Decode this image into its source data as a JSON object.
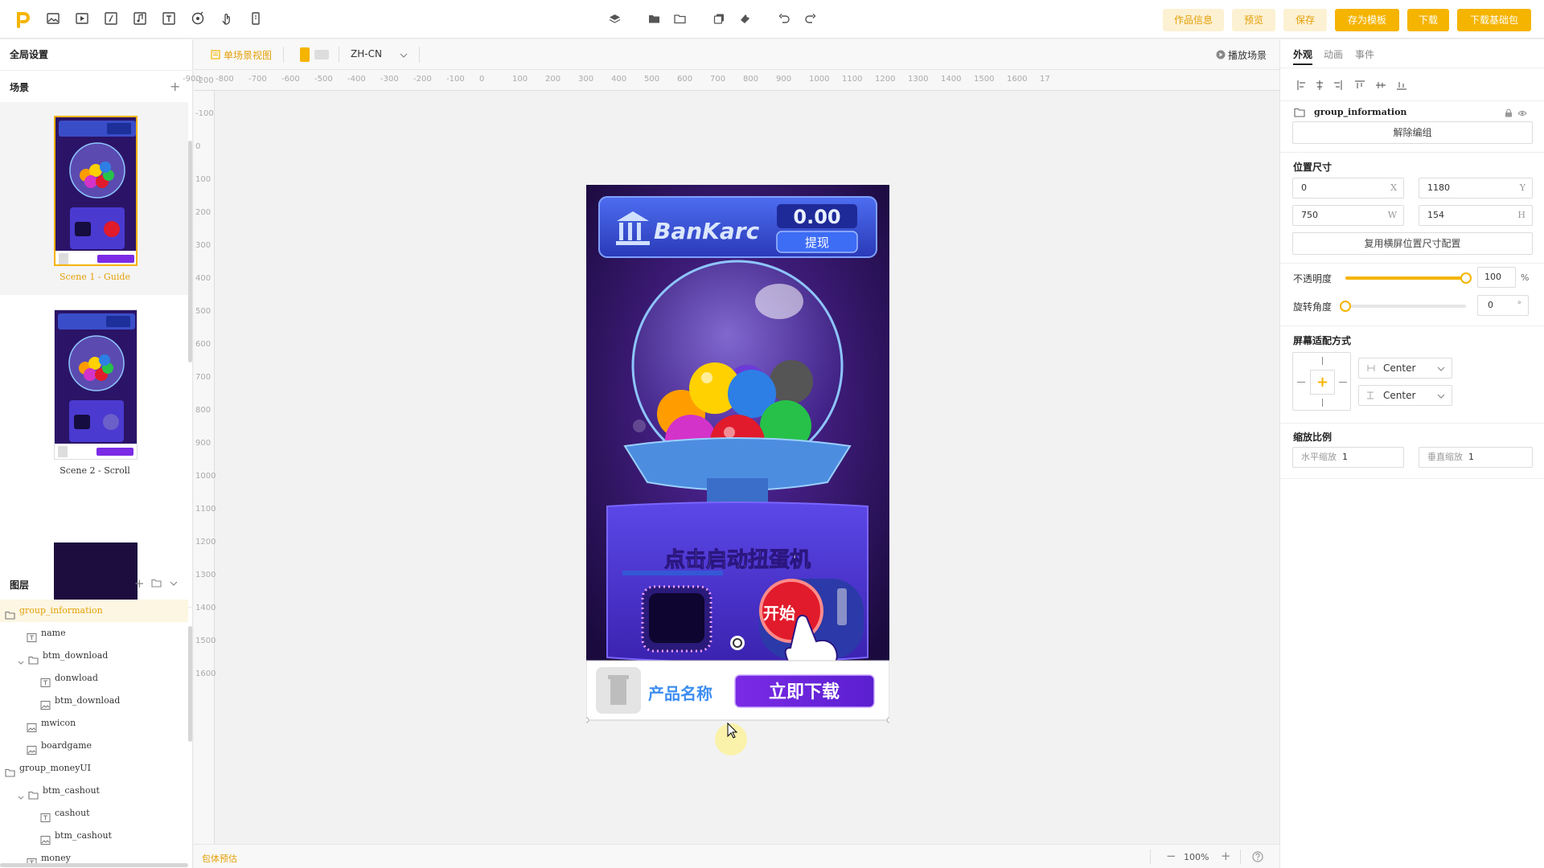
{
  "toolbar": {
    "buttons": {
      "work_info": "作品信息",
      "preview": "预览",
      "save": "保存",
      "save_template": "存为模板",
      "download": "下载",
      "download_base": "下载基础包"
    }
  },
  "left": {
    "global_settings": "全局设置",
    "scenes_title": "场景",
    "scenes": [
      {
        "label": "Scene 1 - Guide"
      },
      {
        "label": "Scene 2 - Scroll"
      }
    ],
    "layers_title": "图层",
    "layers": [
      {
        "name": "group_information",
        "type": "folder",
        "indent": 0,
        "selected": true
      },
      {
        "name": "name",
        "type": "text",
        "indent": 1
      },
      {
        "name": "btm_download",
        "type": "folder",
        "indent": 1,
        "expanded": true
      },
      {
        "name": "donwload",
        "type": "text",
        "indent": 2
      },
      {
        "name": "btm_download",
        "type": "image",
        "indent": 2
      },
      {
        "name": "mwicon",
        "type": "image",
        "indent": 1
      },
      {
        "name": "boardgame",
        "type": "image",
        "indent": 1
      },
      {
        "name": "group_moneyUI",
        "type": "folder",
        "indent": 0
      },
      {
        "name": "btm_cashout",
        "type": "folder",
        "indent": 1,
        "expanded": true
      },
      {
        "name": "cashout",
        "type": "text",
        "indent": 2
      },
      {
        "name": "btm_cashout",
        "type": "image",
        "indent": 2
      },
      {
        "name": "money",
        "type": "text",
        "indent": 1
      }
    ]
  },
  "subtoolbar": {
    "single_view": "单场景视图",
    "language": "ZH-CN",
    "play_scene": "播放场景"
  },
  "ruler": {
    "h": [
      "-900",
      "-800",
      "-700",
      "-600",
      "-500",
      "-400",
      "-300",
      "-200",
      "-100",
      "0",
      "100",
      "200",
      "300",
      "400",
      "500",
      "600",
      "700",
      "800",
      "900",
      "1000",
      "1100",
      "1200",
      "1300",
      "1400",
      "1500",
      "1600",
      "17"
    ],
    "v": [
      "-200",
      "-100",
      "0",
      "100",
      "200",
      "300",
      "400",
      "500",
      "600",
      "700",
      "800",
      "900",
      "1000",
      "1100",
      "1200",
      "1300",
      "1400",
      "1500",
      "1600"
    ]
  },
  "game": {
    "brand": "BanKarc",
    "balance": "0.00",
    "withdraw": "提现",
    "start_text": "点击启动扭蛋机",
    "start_button": "开始",
    "product_name": "产品名称",
    "download_now": "立即下载"
  },
  "status": {
    "bundle_estimate": "包体预估",
    "zoom": "100%"
  },
  "right": {
    "tabs": [
      "外观",
      "动画",
      "事件"
    ],
    "group_name": "group_information",
    "ungroup": "解除编组",
    "pos_title": "位置尺寸",
    "x": "0",
    "x_suffix": "X",
    "y": "1180",
    "y_suffix": "Y",
    "w": "750",
    "w_suffix": "W",
    "h": "154",
    "h_suffix": "H",
    "reuse_landscape": "复用横屏位置尺寸配置",
    "opacity_label": "不透明度",
    "opacity": 100,
    "opacity_value": "100",
    "opacity_unit": "%",
    "rotation_label": "旋转角度",
    "rotation": 0,
    "rotation_value": "0",
    "rotation_unit": "°",
    "fit_title": "屏幕适配方式",
    "fit_h": "Center",
    "fit_v": "Center",
    "scale_title": "缩放比例",
    "scale_h_label": "水平缩放",
    "scale_h": "1",
    "scale_v_label": "垂直缩放",
    "scale_v": "1"
  },
  "colors": {
    "accent": "#f5b400",
    "accent_light": "#fdf1d3"
  }
}
